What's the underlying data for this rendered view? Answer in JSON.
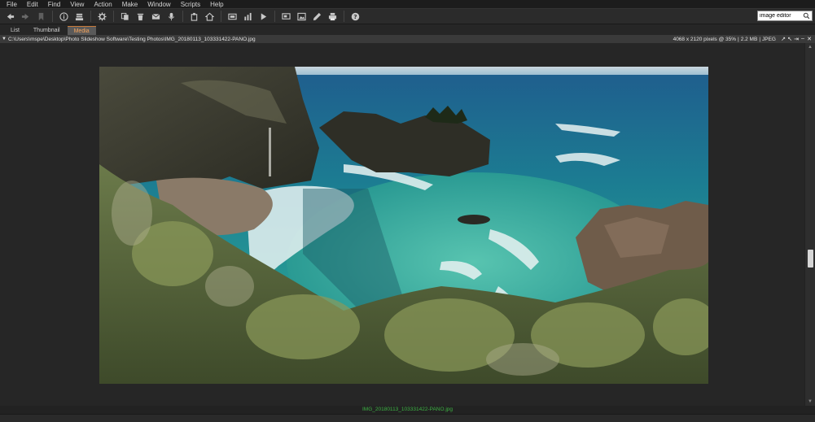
{
  "menu": {
    "items": [
      {
        "label": "File"
      },
      {
        "label": "Edit"
      },
      {
        "label": "Find"
      },
      {
        "label": "View"
      },
      {
        "label": "Action"
      },
      {
        "label": "Make"
      },
      {
        "label": "Window"
      },
      {
        "label": "Scripts"
      },
      {
        "label": "Help"
      }
    ]
  },
  "search": {
    "value": "image editor",
    "icon": "search-icon"
  },
  "tabs": [
    {
      "label": "List",
      "active": false
    },
    {
      "label": "Thumbnail",
      "active": false
    },
    {
      "label": "Media",
      "active": true
    }
  ],
  "pathbar": {
    "path": "C:\\Users\\mspe\\Desktop\\Photo Slideshow Software\\Testing Photos\\IMG_20180113_103331422-PANO.jpg",
    "dimensions": "4068 x 2120 pixels @ 35%",
    "size": "2.2 MB",
    "format": "JPEG"
  },
  "status": {
    "filename": "IMG_20180113_103331422-PANO.jpg"
  },
  "colors": {
    "accent_tab": "#f7a45c",
    "status_text": "#3cb043"
  }
}
